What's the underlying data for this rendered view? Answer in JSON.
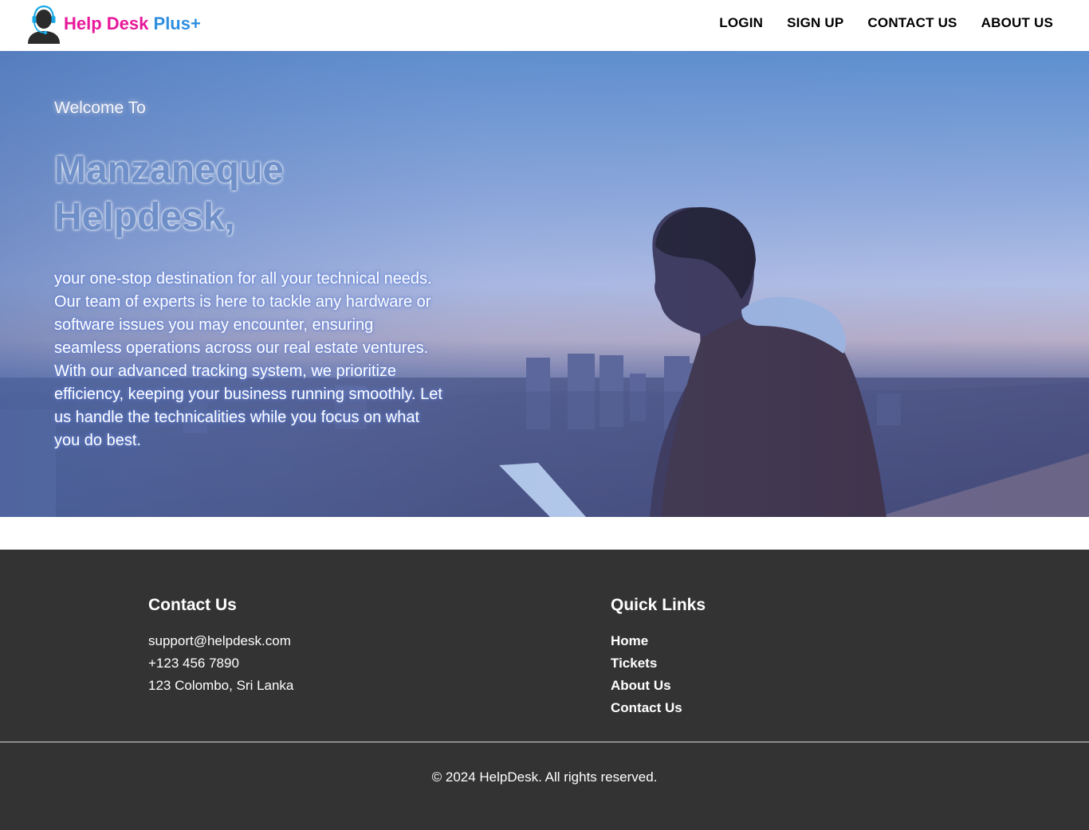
{
  "header": {
    "brand_part1": "Help Desk",
    "brand_part2": "Plus+",
    "brand_colors": {
      "part1": "#e8189a",
      "part2": "#2f8fe0"
    },
    "logo_icon": "support-agent-headset-icon",
    "nav": [
      {
        "label": "LOGIN"
      },
      {
        "label": "SIGN UP"
      },
      {
        "label": "CONTACT US"
      },
      {
        "label": "ABOUT US"
      }
    ]
  },
  "hero": {
    "welcome": "Welcome To",
    "title_line1": "Manzaneque",
    "title_line2": "Helpdesk,",
    "description_p1": "your one-stop destination for all your technical needs. Our team of experts is here to tackle any hardware or software issues you may encounter, ensuring seamless operations across our real estate ventures.",
    "description_p2": "With our advanced tracking system, we prioritize efficiency, keeping your business running smoothly. Let us handle the technicalities while you focus on what you do best."
  },
  "footer": {
    "contact": {
      "heading": "Contact Us",
      "email": "support@helpdesk.com",
      "phone": "+123 456 7890",
      "address": "123 Colombo, Sri Lanka"
    },
    "quick_links": {
      "heading": "Quick Links",
      "items": [
        {
          "label": "Home"
        },
        {
          "label": "Tickets"
        },
        {
          "label": "About Us"
        },
        {
          "label": "Contact Us"
        }
      ]
    },
    "copyright": "© 2024 HelpDesk. All rights reserved.",
    "background_color": "#333333"
  }
}
